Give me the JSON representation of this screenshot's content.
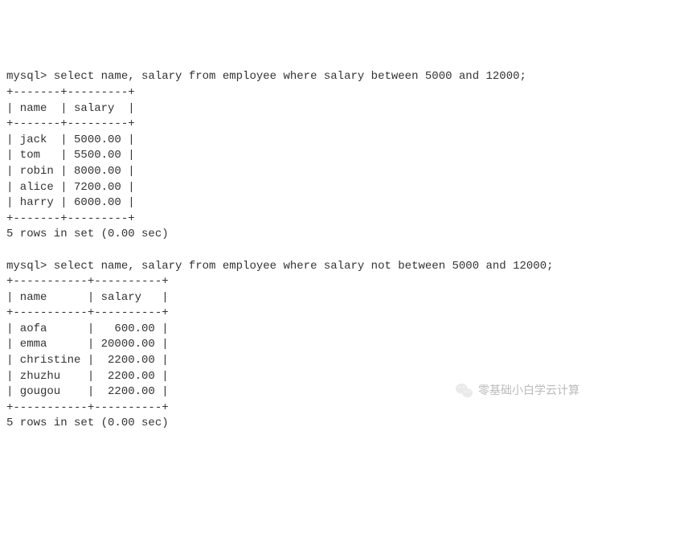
{
  "query1": {
    "prompt": "mysql> ",
    "sql": "select name, salary from employee where salary between 5000 and 12000;",
    "columns": [
      "name",
      "salary"
    ],
    "rows": [
      {
        "name": "jack",
        "salary": "5000.00"
      },
      {
        "name": "tom",
        "salary": "5500.00"
      },
      {
        "name": "robin",
        "salary": "8000.00"
      },
      {
        "name": "alice",
        "salary": "7200.00"
      },
      {
        "name": "harry",
        "salary": "6000.00"
      }
    ],
    "footer": "5 rows in set (0.00 sec)",
    "border_top": "+-------+---------+",
    "header_row": "| name  | salary  |",
    "data_rows": [
      "| jack  | 5000.00 |",
      "| tom   | 5500.00 |",
      "| robin | 8000.00 |",
      "| alice | 7200.00 |",
      "| harry | 6000.00 |"
    ]
  },
  "query2": {
    "prompt": "mysql> ",
    "sql": "select name, salary from employee where salary not between 5000 and 12000;",
    "columns": [
      "name",
      "salary"
    ],
    "rows": [
      {
        "name": "aofa",
        "salary": "600.00"
      },
      {
        "name": "emma",
        "salary": "20000.00"
      },
      {
        "name": "christine",
        "salary": "2200.00"
      },
      {
        "name": "zhuzhu",
        "salary": "2200.00"
      },
      {
        "name": "gougou",
        "salary": "2200.00"
      }
    ],
    "footer": "5 rows in set (0.00 sec)",
    "border_top": "+-----------+----------+",
    "header_row": "| name      | salary   |",
    "data_rows": [
      "| aofa      |   600.00 |",
      "| emma      | 20000.00 |",
      "| christine |  2200.00 |",
      "| zhuzhu    |  2200.00 |",
      "| gougou    |  2200.00 |"
    ]
  },
  "watermark": {
    "text": "零基础小白学云计算"
  }
}
